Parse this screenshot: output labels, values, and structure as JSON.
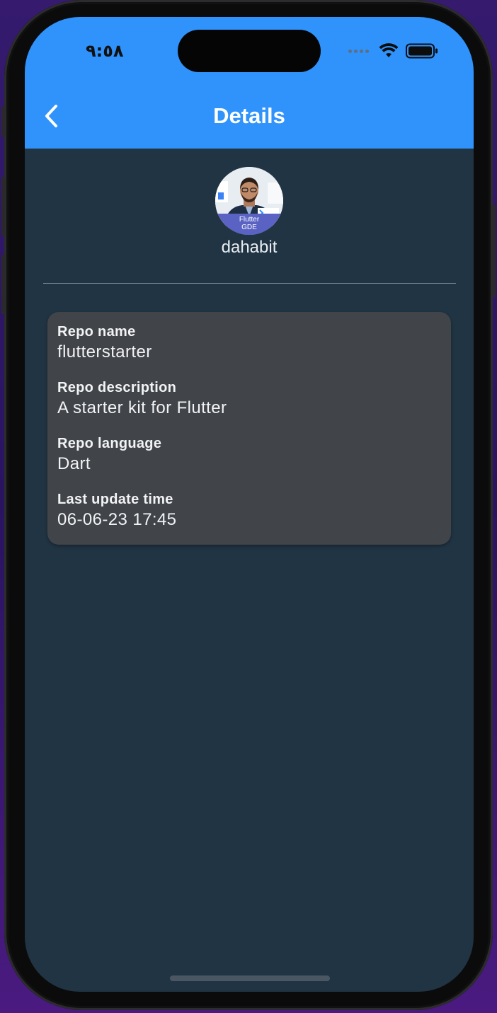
{
  "status_bar": {
    "time": "٩:٥٨"
  },
  "appbar": {
    "title": "Details",
    "back_icon": "chevron-left-icon",
    "background": "#2f93fb"
  },
  "profile": {
    "username": "dahabit",
    "avatar_badge_line1": "Flutter",
    "avatar_badge_line2": "GDE"
  },
  "repo_details": [
    {
      "label": "Repo name",
      "value": "flutterstarter"
    },
    {
      "label": "Repo description",
      "value": "A starter kit for Flutter"
    },
    {
      "label": "Repo language",
      "value": "Dart"
    },
    {
      "label": "Last update time",
      "value": "06-06-23 17:45"
    }
  ],
  "colors": {
    "screen_background": "#213443",
    "card_background": "#414449",
    "accent": "#2f93fb"
  }
}
